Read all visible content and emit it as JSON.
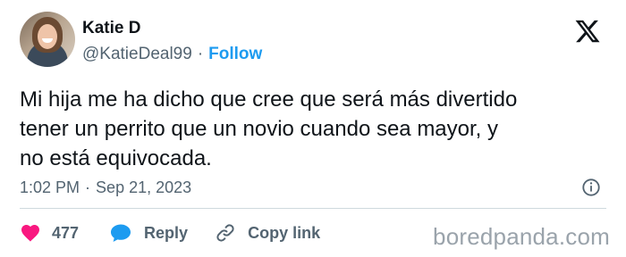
{
  "author": {
    "name": "Katie D",
    "handle": "@KatieDeal99",
    "separator": "·",
    "follow_label": "Follow"
  },
  "platform_icon": "x-logo-icon",
  "tweet": {
    "lines": [
      "Mi hija me ha dicho que cree que será más divertido",
      "tener un perrito que un novio cuando sea mayor, y",
      "no está equivocada."
    ]
  },
  "meta": {
    "time": "1:02 PM",
    "separator": "·",
    "date": "Sep 21, 2023"
  },
  "actions": {
    "likes": "477",
    "reply_label": "Reply",
    "copy_label": "Copy link"
  },
  "watermark": "boredpanda.com",
  "colors": {
    "text": "#0f1419",
    "secondary": "#536471",
    "link": "#1d9bf0",
    "heart": "#f91880",
    "reply": "#1d9bf0",
    "divider": "#cfd9de",
    "watermark": "#9aa3ab"
  },
  "icons": [
    "avatar",
    "x-logo-icon",
    "info-icon",
    "heart-icon",
    "reply-bubble-icon",
    "link-icon"
  ]
}
